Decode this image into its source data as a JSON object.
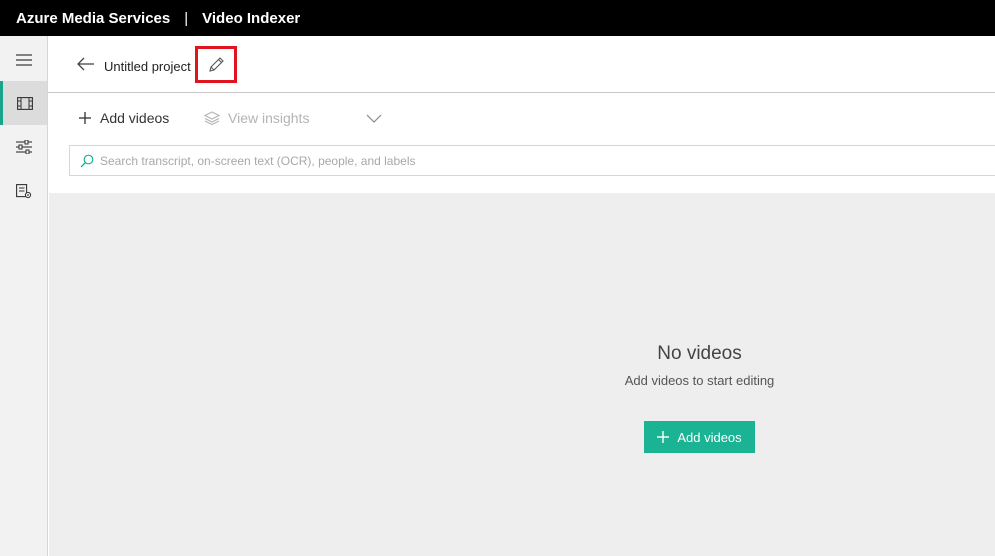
{
  "topbar": {
    "brand": "Azure Media Services",
    "separator": "|",
    "product": "Video Indexer"
  },
  "nav": {
    "items": [
      {
        "icon": "hamburger-icon"
      },
      {
        "icon": "film-icon",
        "active": true
      },
      {
        "icon": "sliders-icon"
      },
      {
        "icon": "document-settings-icon"
      }
    ]
  },
  "header": {
    "project_title": "Untitled project",
    "back_icon": "arrow-left-icon",
    "edit_icon": "pencil-icon"
  },
  "toolbar": {
    "add_videos_label": "Add videos",
    "view_insights_label": "View insights",
    "view_insights_disabled": true
  },
  "search": {
    "placeholder": "Search transcript, on-screen text (OCR), people, and labels",
    "value": ""
  },
  "empty_state": {
    "title": "No videos",
    "subtitle": "Add videos to start editing",
    "button_label": "Add videos"
  },
  "colors": {
    "accent": "#1ab394",
    "highlight_box": "#e0141e",
    "topbar_bg": "#000000",
    "main_bg": "#eeeeee"
  }
}
